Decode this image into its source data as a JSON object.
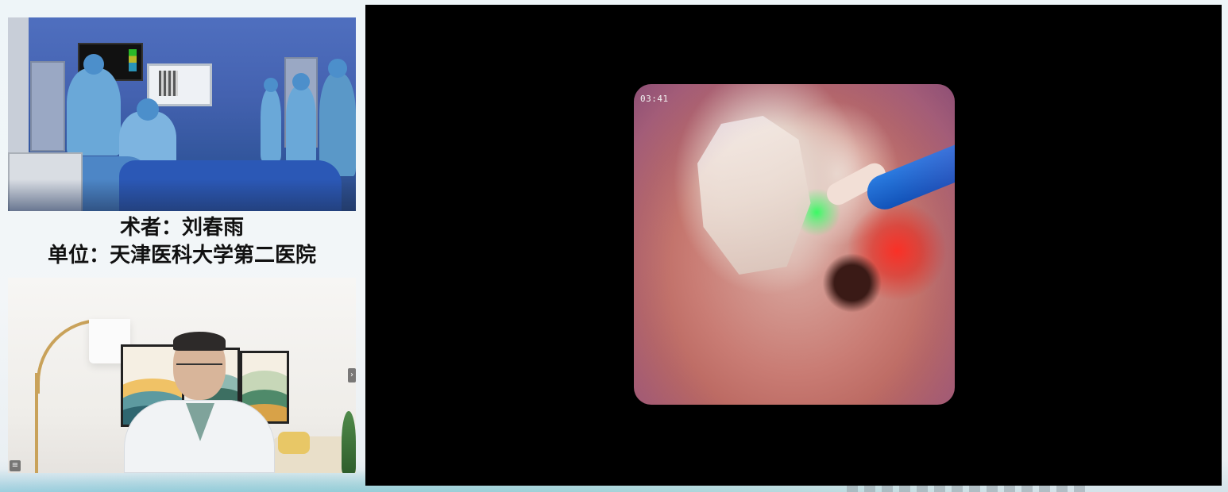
{
  "left_panel": {
    "caption": {
      "surgeon_line": "术者：刘春雨",
      "unit_line": "单位：天津医科大学第二医院"
    },
    "operating_room_video": {
      "description": "operating-room-camera"
    },
    "speaker_video": {
      "description": "speaker-camera"
    }
  },
  "main_video": {
    "endoscope_timestamp": "03:41"
  },
  "icons": {
    "tile_list": "list-icon",
    "tile_next": "chevron-right-icon"
  },
  "colors": {
    "main_background": "#000000",
    "laser_green": "#28ff5a",
    "probe_blue": "#1a63cc"
  }
}
